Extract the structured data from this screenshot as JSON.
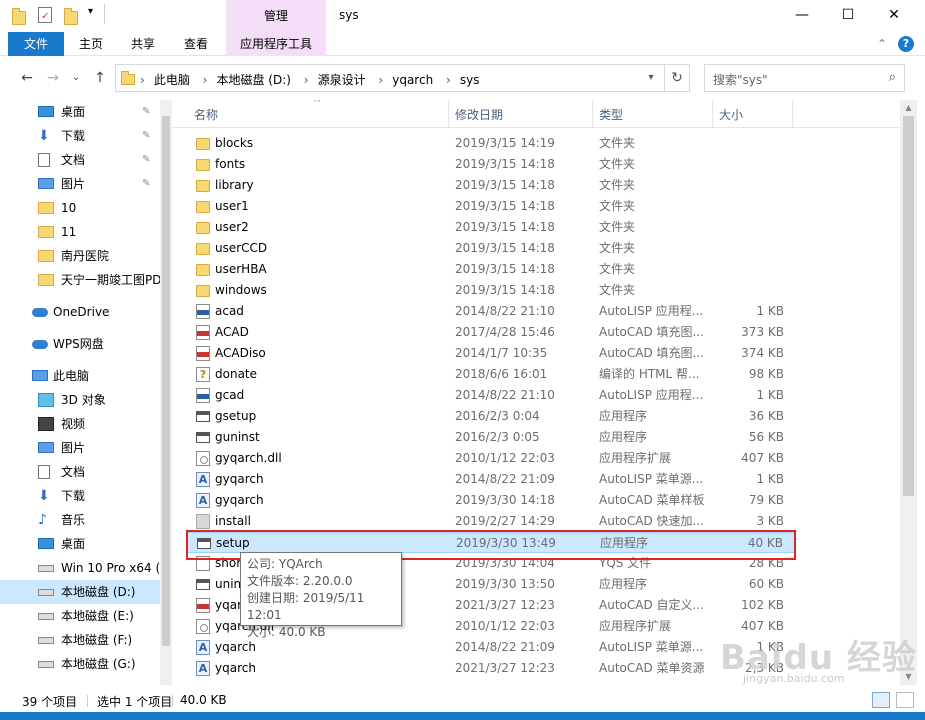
{
  "window": {
    "title": "sys",
    "context_group": "管理",
    "minimize_glyph": "—",
    "maximize_glyph": "☐",
    "close_glyph": "✕"
  },
  "ribbon": {
    "file_tab": "文件",
    "tabs": [
      "主页",
      "共享",
      "查看"
    ],
    "context_tab": "应用程序工具",
    "collapse_glyph": "⌃",
    "help_glyph": "?"
  },
  "address": {
    "crumbs": [
      "此电脑",
      "本地磁盘 (D:)",
      "源泉设计",
      "yqarch",
      "sys"
    ],
    "search_placeholder": "搜索\"sys\"",
    "back_glyph": "←",
    "forward_glyph": "→",
    "recent_glyph": "⌄",
    "up_glyph": "↑",
    "refresh_glyph": "↻",
    "search_glyph": "⌕"
  },
  "nav": {
    "items": [
      {
        "label": "桌面",
        "icon": "desktop-icon",
        "pinned": true
      },
      {
        "label": "下载",
        "icon": "download-icon",
        "pinned": true
      },
      {
        "label": "文档",
        "icon": "documents-icon",
        "pinned": true
      },
      {
        "label": "图片",
        "icon": "pictures-icon",
        "pinned": true
      },
      {
        "label": "10",
        "icon": "folder-icon",
        "pinned": false
      },
      {
        "label": "11",
        "icon": "folder-icon",
        "pinned": false
      },
      {
        "label": "南丹医院",
        "icon": "folder-icon",
        "pinned": false
      },
      {
        "label": "天宁一期竣工图PD",
        "icon": "folder-icon",
        "pinned": false
      },
      {
        "label": "OneDrive",
        "icon": "cloud-icon",
        "pinned": false
      },
      {
        "label": "WPS网盘",
        "icon": "cloud-icon",
        "pinned": false
      },
      {
        "label": "此电脑",
        "icon": "computer-icon",
        "pinned": false
      },
      {
        "label": "3D 对象",
        "icon": "3d-objects-icon",
        "pinned": false
      },
      {
        "label": "视频",
        "icon": "video-icon",
        "pinned": false
      },
      {
        "label": "图片",
        "icon": "pictures-icon",
        "pinned": false
      },
      {
        "label": "文档",
        "icon": "documents-icon",
        "pinned": false
      },
      {
        "label": "下载",
        "icon": "download-icon",
        "pinned": false
      },
      {
        "label": "音乐",
        "icon": "music-icon",
        "pinned": false
      },
      {
        "label": "桌面",
        "icon": "desktop-icon",
        "pinned": false
      },
      {
        "label": "Win 10 Pro x64 (C",
        "icon": "drive-icon",
        "pinned": false
      },
      {
        "label": "本地磁盘 (D:)",
        "icon": "drive-icon",
        "pinned": false
      },
      {
        "label": "本地磁盘 (E:)",
        "icon": "drive-icon",
        "pinned": false
      },
      {
        "label": "本地磁盘 (F:)",
        "icon": "drive-icon",
        "pinned": false
      },
      {
        "label": "本地磁盘 (G:)",
        "icon": "drive-icon",
        "pinned": false
      }
    ],
    "pin_glyph": "📌"
  },
  "columns": {
    "name": "名称",
    "date": "修改日期",
    "type": "类型",
    "size": "大小",
    "sort_glyph": "^"
  },
  "files": [
    {
      "name": "blocks",
      "date": "2019/3/15 14:19",
      "type": "文件夹",
      "size": "",
      "icon": "folder"
    },
    {
      "name": "fonts",
      "date": "2019/3/15 14:18",
      "type": "文件夹",
      "size": "",
      "icon": "folder"
    },
    {
      "name": "library",
      "date": "2019/3/15 14:18",
      "type": "文件夹",
      "size": "",
      "icon": "folder"
    },
    {
      "name": "user1",
      "date": "2019/3/15 14:18",
      "type": "文件夹",
      "size": "",
      "icon": "folder"
    },
    {
      "name": "user2",
      "date": "2019/3/15 14:18",
      "type": "文件夹",
      "size": "",
      "icon": "folder"
    },
    {
      "name": "userCCD",
      "date": "2019/3/15 14:18",
      "type": "文件夹",
      "size": "",
      "icon": "folder"
    },
    {
      "name": "userHBA",
      "date": "2019/3/15 14:18",
      "type": "文件夹",
      "size": "",
      "icon": "folder"
    },
    {
      "name": "windows",
      "date": "2019/3/15 14:18",
      "type": "文件夹",
      "size": "",
      "icon": "folder"
    },
    {
      "name": "acad",
      "date": "2014/8/22 21:10",
      "type": "AutoLISP 应用程...",
      "size": "1 KB",
      "icon": "lsp"
    },
    {
      "name": "ACAD",
      "date": "2017/4/28 15:46",
      "type": "AutoCAD 填充图...",
      "size": "373 KB",
      "icon": "pat"
    },
    {
      "name": "ACADiso",
      "date": "2014/1/7 10:35",
      "type": "AutoCAD 填充图...",
      "size": "374 KB",
      "icon": "pat"
    },
    {
      "name": "donate",
      "date": "2018/6/6 16:01",
      "type": "编译的 HTML 帮...",
      "size": "98 KB",
      "icon": "help"
    },
    {
      "name": "gcad",
      "date": "2014/8/22 21:10",
      "type": "AutoLISP 应用程...",
      "size": "1 KB",
      "icon": "lsp"
    },
    {
      "name": "gsetup",
      "date": "2016/2/3 0:04",
      "type": "应用程序",
      "size": "36 KB",
      "icon": "exe"
    },
    {
      "name": "guninst",
      "date": "2016/2/3 0:05",
      "type": "应用程序",
      "size": "56 KB",
      "icon": "exe"
    },
    {
      "name": "gyqarch.dll",
      "date": "2010/1/12 22:03",
      "type": "应用程序扩展",
      "size": "407 KB",
      "icon": "dll"
    },
    {
      "name": "gyqarch",
      "date": "2014/8/22 21:09",
      "type": "AutoLISP 菜单源...",
      "size": "1 KB",
      "icon": "mnu"
    },
    {
      "name": "gyqarch",
      "date": "2019/3/30 14:18",
      "type": "AutoCAD 菜单样板",
      "size": "79 KB",
      "icon": "mnu"
    },
    {
      "name": "install",
      "date": "2019/2/27 14:29",
      "type": "AutoCAD 快速加...",
      "size": "3 KB",
      "icon": "inst"
    },
    {
      "name": "setup",
      "date": "2019/3/30 13:49",
      "type": "应用程序",
      "size": "40 KB",
      "icon": "exe",
      "selected": true
    },
    {
      "name": "shor",
      "date": "2019/3/30 14:04",
      "type": "YQS 文件",
      "size": "28 KB",
      "icon": "doc"
    },
    {
      "name": "unin",
      "date": "2019/3/30 13:50",
      "type": "应用程序",
      "size": "60 KB",
      "icon": "exe"
    },
    {
      "name": "yqar",
      "date": "2021/3/27 12:23",
      "type": "AutoCAD 自定义...",
      "size": "102 KB",
      "icon": "cui"
    },
    {
      "name": "yqarch.dll",
      "date": "2010/1/12 22:03",
      "type": "应用程序扩展",
      "size": "407 KB",
      "icon": "dll"
    },
    {
      "name": "yqarch",
      "date": "2014/8/22 21:09",
      "type": "AutoLISP 菜单源...",
      "size": "1 KB",
      "icon": "mnu"
    },
    {
      "name": "yqarch",
      "date": "2021/3/27 12:23",
      "type": "AutoCAD 菜单资源",
      "size": "2,3 KB",
      "icon": "mnu"
    }
  ],
  "tooltip": {
    "lines": [
      "公司: YQArch",
      "文件版本: 2.20.0.0",
      "创建日期: 2019/5/11 12:01",
      "大小: 40.0 KB"
    ]
  },
  "status": {
    "count": "39 个项目",
    "selected": "选中 1 个项目",
    "size": "40.0 KB"
  },
  "watermark": {
    "brand": "Baidu 经验",
    "url": "jingyan.baidu.com"
  },
  "colors": {
    "accent": "#1979ca",
    "context_tab": "#f3ddf7",
    "selection": "#cce8ff",
    "highlight_box": "#e02424"
  }
}
